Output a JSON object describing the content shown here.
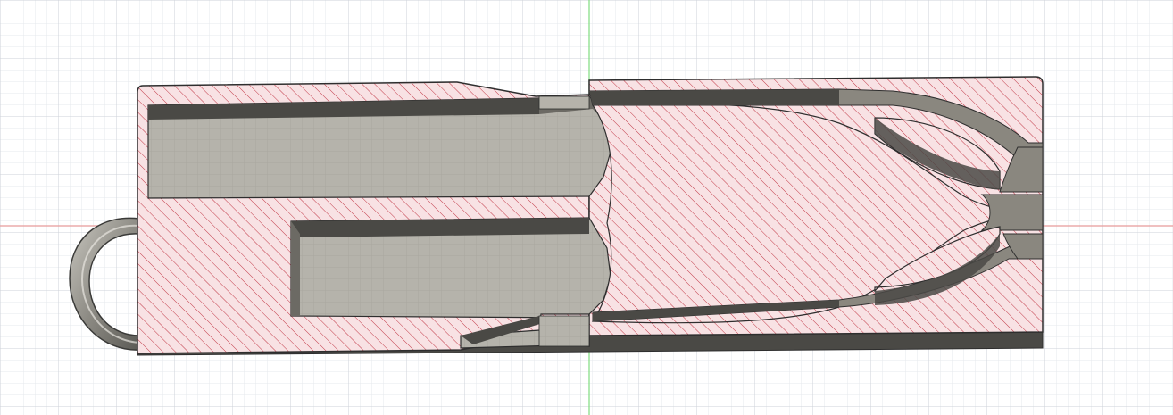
{
  "viewport": {
    "kind": "cad-section-view",
    "grid": true,
    "colors": {
      "background": "#ffffff",
      "grid_minor": "#e6e8ec",
      "grid_major": "#cdd2d9",
      "axis_vertical": "#7fdc7f",
      "axis_horizontal": "#e89a9a",
      "section_fill": "#f8e2e4",
      "section_hatch": "#c23a48",
      "body_shade": "#8a877f",
      "body_dark": "#4a4945",
      "cavity_floor": "#b5b3ab",
      "outline": "#2e2e2e"
    }
  },
  "parts": [
    {
      "name": "left-housing-section",
      "type": "section-face"
    },
    {
      "name": "right-housing-section",
      "type": "section-face"
    },
    {
      "name": "keyring-loop",
      "type": "shaded-body"
    },
    {
      "name": "upper-slot-cavity",
      "type": "cavity"
    },
    {
      "name": "lower-slot-cavity",
      "type": "cavity"
    },
    {
      "name": "upper-flex-arm",
      "type": "cavity"
    },
    {
      "name": "lower-flex-arm",
      "type": "cavity"
    }
  ]
}
